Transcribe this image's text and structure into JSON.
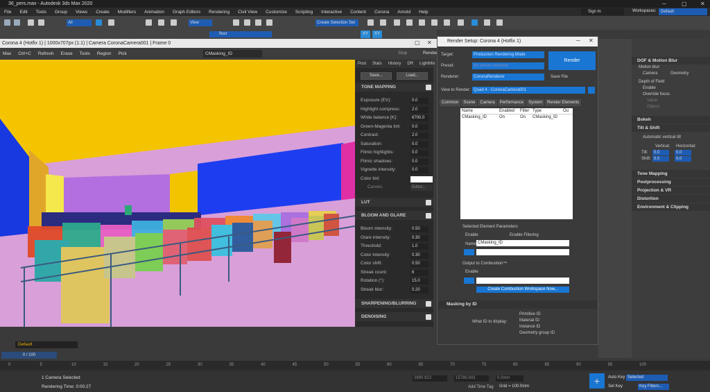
{
  "app": {
    "title": "36_pers.max - Autodesk 3ds Max 2020",
    "signin": "Sign In",
    "workspaces_label": "Workspaces:",
    "workspace_value": "Default"
  },
  "menu": [
    "File",
    "Edit",
    "Tools",
    "Group",
    "Views",
    "Create",
    "Modifiers",
    "Animation",
    "Graph Editors",
    "Rendering",
    "Civil View",
    "Customize",
    "Scripting",
    "Interactive",
    "Content",
    "Corona",
    "Arnold",
    "Help"
  ],
  "toolbar": {
    "selection_filter": "All",
    "view": "View",
    "selection_set": "Create Selection Set",
    "layer": "floor"
  },
  "vfb": {
    "title": "Corona 4 (Hotfix 1) | 1000x707px (1:1) | Camera CoronaCamera001 | Frame 0",
    "tools": [
      "Max",
      "Ctrl+C",
      "Refresh",
      "Erase",
      "Tools",
      "Region",
      "Pick"
    ],
    "element": "CMasking_ID",
    "stop": "Stop",
    "render": "Render"
  },
  "panel": {
    "tabs": [
      "Post",
      "Stats",
      "History",
      "DR",
      "LightMix"
    ],
    "save": "Save...",
    "load": "Load...",
    "tone_mapping": "TONE MAPPING",
    "tone_rows": [
      [
        "Exposure (EV):",
        "0.0"
      ],
      [
        "Highlight compress:",
        "2.0"
      ],
      [
        "White balance [K]:",
        "6700.0"
      ],
      [
        "Green-Magenta tint:",
        "0.0"
      ],
      [
        "Contrast:",
        "2.0"
      ],
      [
        "Saturation:",
        "0.0"
      ],
      [
        "Filmic highlights:",
        "0.0"
      ],
      [
        "Filmic shadows:",
        "0.0"
      ],
      [
        "Vignette intensity:",
        "0.0"
      ]
    ],
    "color_tint": "Color tint:",
    "curves": "Curves:",
    "curves_btn": "Editor...",
    "lut": "LUT",
    "bloom": "BLOOM AND GLARE",
    "bloom_rows": [
      [
        "Bloom intensity:",
        "0.50"
      ],
      [
        "Glare intensity:",
        "0.30"
      ],
      [
        "Threshold:",
        "1.0"
      ],
      [
        "Color intensity:",
        "0.30"
      ],
      [
        "Color shift:",
        "0.50"
      ],
      [
        "Streak count:",
        "6"
      ],
      [
        "Rotation (°):",
        "15.0"
      ],
      [
        "Streak blur:",
        "0.20"
      ]
    ],
    "sharpening": "SHARPENING/BLURRING",
    "denoising": "DENOISING"
  },
  "render_setup": {
    "title": "Render Setup: Corona 4 (Hotfix 1)",
    "target_label": "Target:",
    "target": "Production Rendering Mode",
    "preset_label": "Preset:",
    "preset": "No preset selected",
    "renderer_label": "Renderer:",
    "renderer": "CoronaRenderer",
    "save_file": "Save File",
    "view_label": "View to Render:",
    "view": "Quad 4 - CoronaCamera001",
    "render_btn": "Render",
    "tabs": [
      "Common",
      "Scene",
      "Camera",
      "Performance",
      "System",
      "Render Elements"
    ],
    "cols": [
      "Name",
      "Enabled",
      "Filter",
      "Type",
      "Ou"
    ],
    "row": [
      "CMasking_ID",
      "On",
      "On",
      "CMasking_ID"
    ],
    "sel_params": "Selected Element Parameters",
    "enable": "Enable",
    "enable_filter": "Enable Filtering",
    "name_label": "Name:",
    "name_value": "CMasking_ID",
    "output_comb": "Output to Combustion™",
    "enable2": "Enable",
    "comb_btn": "Create Combustion Workspace Now...",
    "masking": "Masking by ID",
    "what_id": "What ID to display:",
    "ids": [
      "Primitive ID",
      "Material ID",
      "Instance ID",
      "Geometry group ID"
    ]
  },
  "right": {
    "sections": [
      "DOF & Motion Blur",
      "Bokeh",
      "Tilt & Shift",
      "Tone Mapping",
      "Postprocessing",
      "Projection & VR",
      "Distortion",
      "Environment & Clipping"
    ],
    "motion_blur": "Motion blur:",
    "camera": "Camera",
    "geometry": "Geometry",
    "dof": "Depth of Field",
    "enable": "Enable",
    "override": "Override focus",
    "value": "Value:",
    "object": "Object:",
    "auto_tilt": "Automatic vertical tilt",
    "vertical": "Vertical:",
    "horizontal": "Horizontal:",
    "tilt": "Tilt:",
    "shift": "Shift:",
    "tilt_v": "0.0",
    "tilt_h": "0.0",
    "shift_v": "0.0",
    "shift_h": "0.0"
  },
  "bottom": {
    "layer": "Default",
    "frame": "0 / 100",
    "ticks": [
      "0",
      "5",
      "10",
      "15",
      "20",
      "25",
      "30",
      "35",
      "40",
      "45",
      "50",
      "55",
      "60",
      "65",
      "70",
      "75",
      "80",
      "85",
      "90",
      "95",
      "100"
    ],
    "selected": "1 Camera Selected",
    "time": "Rendering Time: 0:00:27",
    "x": "2890.923",
    "y": "15786.903",
    "z": "0.0mm",
    "grid": "Grid = 100.0mm",
    "add_time_tag": "Add Time Tag",
    "auto_key": "Auto Key",
    "set_key": "Set Key",
    "selected_dd": "Selected",
    "key_filters": "Key Filters..."
  }
}
